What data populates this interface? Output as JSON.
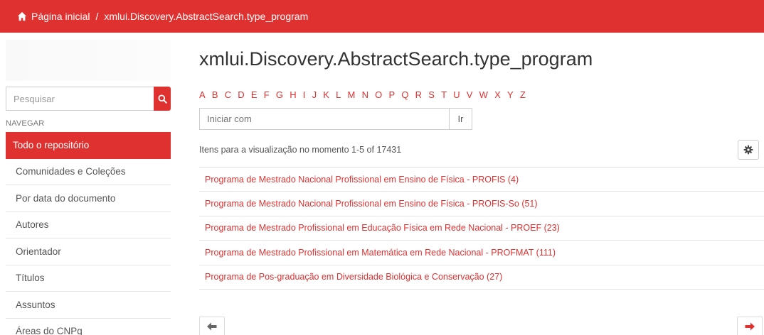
{
  "breadcrumb": {
    "home_label": "Página inicial",
    "separator": "/",
    "current": "xmlui.Discovery.AbstractSearch.type_program"
  },
  "sidebar": {
    "search_placeholder": "Pesquisar",
    "nav_heading": "NAVEGAR",
    "items": [
      {
        "label": "Todo o repositório",
        "active": true
      },
      {
        "label": "Comunidades e Coleções"
      },
      {
        "label": "Por data do documento"
      },
      {
        "label": "Autores"
      },
      {
        "label": "Orientador"
      },
      {
        "label": "Títulos"
      },
      {
        "label": "Assuntos"
      },
      {
        "label": "Áreas do CNPq"
      }
    ]
  },
  "main": {
    "title": "xmlui.Discovery.AbstractSearch.type_program",
    "alphabet": [
      "A",
      "B",
      "C",
      "D",
      "E",
      "F",
      "G",
      "H",
      "I",
      "J",
      "K",
      "L",
      "M",
      "N",
      "O",
      "P",
      "Q",
      "R",
      "S",
      "T",
      "U",
      "V",
      "W",
      "X",
      "Y",
      "Z"
    ],
    "start_with_placeholder": "Iniciar com",
    "go_label": "Ir",
    "items_info": "Itens para a visualização no momento 1-5 of 17431",
    "results": [
      "Programa de Mestrado Nacional Profissional em Ensino de Física - PROFIS (4)",
      "Programa de Mestrado Nacional Profissional em Ensino de Física - PROFIS-So (51)",
      "Programa de Mestrado Profissional em Educação Física em Rede Nacional - PROEF (23)",
      "Programa de Mestrado Profissional em Matemática em Rede Nacional - PROFMAT (111)",
      "Programa de Pos-graduação em Diversidade Biológica e Conservação (27)"
    ]
  },
  "colors": {
    "accent": "#e03131",
    "prev_arrow": "#666666",
    "next_arrow": "#e03131"
  },
  "icons": {
    "home": "home-icon",
    "search": "search-icon",
    "settings": "gear-icon",
    "previous": "arrow-left-icon",
    "next": "arrow-right-icon"
  }
}
